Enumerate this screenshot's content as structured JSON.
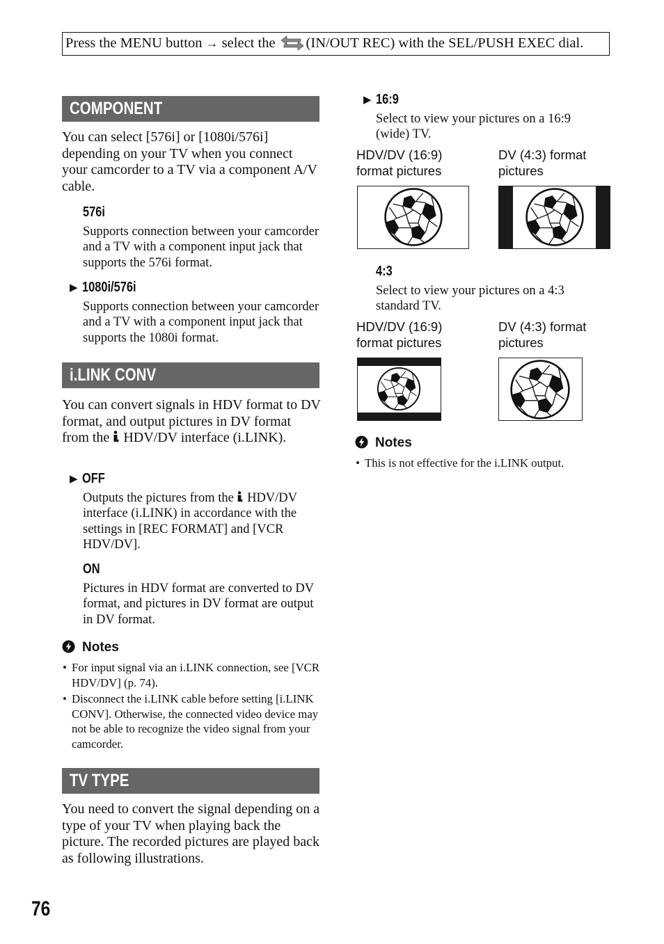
{
  "header": {
    "instruction_part1": "Press the MENU button",
    "arrow": "→",
    "instruction_part2": "select the",
    "icon": "in-out-rec-icon",
    "instruction_part3": "(IN/OUT REC) with the SEL/PUSH EXEC dial."
  },
  "sections": {
    "component": {
      "title": "COMPONENT",
      "intro": "You can select [576i] or [1080i/576i] depending on your TV when you connect your camcorder to a TV via a component A/V cable.",
      "options": [
        {
          "label": "576i",
          "default": false,
          "marker": "",
          "text": "Supports connection between your camcorder and a TV with a component input jack that supports the 576i format."
        },
        {
          "label": "1080i/576i",
          "default": true,
          "marker": "▶",
          "text": "Supports connection between your camcorder and a TV with a component input jack that supports the 1080i format."
        }
      ]
    },
    "ilink_conv": {
      "title": "i.LINK CONV",
      "intro_before_icon": "You can convert signals in HDV format to DV format, and output pictures in DV format from the",
      "intro_icon": "ilink-icon",
      "intro_after_icon": "HDV/DV interface (i.LINK).",
      "options": [
        {
          "label": "OFF",
          "default": true,
          "marker": "▶",
          "text_before_icon": "Outputs the pictures from the",
          "text_after_icon": "HDV/DV interface (i.LINK) in accordance with the settings in [REC FORMAT] and [VCR HDV/DV]."
        },
        {
          "label": "ON",
          "default": false,
          "marker": "",
          "text": "Pictures in HDV format are converted to DV format, and pictures in DV format are output in DV format."
        }
      ],
      "notes_title": "Notes",
      "notes": [
        "For input signal via an i.LINK connection, see [VCR HDV/DV] (p. 74).",
        "Disconnect the i.LINK cable before setting [i.LINK CONV]. Otherwise, the connected video device may not be able to recognize the video signal from your camcorder."
      ]
    },
    "tv_type": {
      "title": "TV TYPE",
      "intro": "You need to convert the signal depending on a type of your TV when playing back the picture. The recorded pictures are played back as following illustrations.",
      "options": [
        {
          "label": "16:9",
          "default": true,
          "marker": "▶",
          "text": "Select to view your pictures on a 16:9 (wide) TV.",
          "figures": [
            {
              "caption": "HDV/DV (16:9) format pictures",
              "display": "full-wide"
            },
            {
              "caption": "DV (4:3) format pictures",
              "display": "pillarbox"
            }
          ]
        },
        {
          "label": "4:3",
          "default": false,
          "marker": "",
          "text": "Select to view your pictures on a 4:3 standard TV.",
          "figures": [
            {
              "caption": "HDV/DV (16:9) format pictures",
              "display": "letterbox"
            },
            {
              "caption": "DV (4:3) format pictures",
              "display": "full-standard"
            }
          ]
        }
      ],
      "notes_title": "Notes",
      "notes": [
        "This is not effective for the i.LINK output."
      ]
    }
  },
  "page_number": "76",
  "colors": {
    "section_header_bg": "#666666",
    "section_header_text": "#ffffff",
    "text": "#111111"
  }
}
